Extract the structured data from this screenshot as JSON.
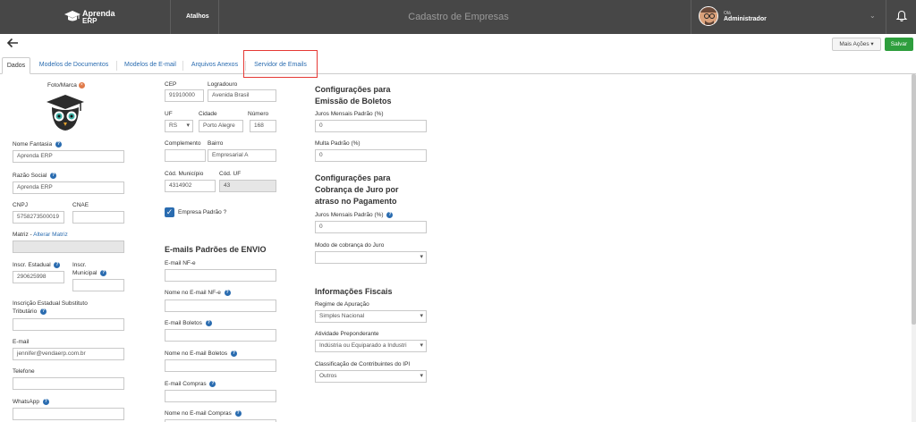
{
  "header": {
    "logo_line1": "Aprenda",
    "logo_line2": "ERP",
    "shortcuts": "Atalhos",
    "title": "Cadastro de Empresas",
    "user_greeting": "Olá",
    "user_name": "Administrador"
  },
  "toolbar": {
    "more_actions": "Mais Ações",
    "save": "Salvar"
  },
  "tabs": [
    {
      "label": "Dados",
      "active": true
    },
    {
      "label": "Modelos de Documentos",
      "active": false
    },
    {
      "label": "Modelos de E-mail",
      "active": false
    },
    {
      "label": "Arquivos Anexos",
      "active": false
    },
    {
      "label": "Servidor de Emails",
      "active": false,
      "highlighted": true
    }
  ],
  "col1": {
    "photo_label": "Foto/Marca",
    "nome_fantasia_label": "Nome Fantasia",
    "nome_fantasia_value": "Aprenda ERP",
    "razao_social_label": "Razão Social",
    "razao_social_value": "Aprenda ERP",
    "cnpj_label": "CNPJ",
    "cnpj_value": "5758273500019",
    "cnae_label": "CNAE",
    "cnae_value": "",
    "matriz_label": "Matriz -",
    "matriz_link": "Alterar Matriz",
    "inscr_estadual_label": "Inscr. Estadual",
    "inscr_estadual_value": "290625998",
    "inscr_municipal_label1": "Inscr.",
    "inscr_municipal_label2": "Municipal",
    "inscr_municipal_value": "",
    "inscr_subst_label1": "Inscrição Estadual Substituto",
    "inscr_subst_label2": "Tributário",
    "email_label": "E-mail",
    "email_value": "jennifer@vendaerp.com.br",
    "telefone_label": "Telefone",
    "whatsapp_label": "WhatsApp"
  },
  "col2": {
    "cep_label": "CEP",
    "cep_value": "91910000",
    "logradouro_label": "Logradouro",
    "logradouro_value": "Avenida Brasil",
    "uf_label": "UF",
    "uf_value": "RS",
    "cidade_label": "Cidade",
    "cidade_value": "Porto Alegre",
    "numero_label": "Número",
    "numero_value": "168",
    "complemento_label": "Complemento",
    "bairro_label": "Bairro",
    "bairro_value": "Empresarial A",
    "cod_municipio_label": "Cód. Município",
    "cod_municipio_value": "4314902",
    "cod_uf_label": "Cód. UF",
    "cod_uf_value": "43",
    "empresa_padrao_label": "Empresa Padrão ?",
    "emails_title": "E-mails Padrões de ENVIO",
    "email_nfe_label": "E-mail NF-e",
    "nome_email_nfe_label": "Nome no E-mail NF-e",
    "email_boletos_label": "E-mail Boletos",
    "nome_email_boletos_label": "Nome no E-mail Boletos",
    "email_compras_label": "E-mail Compras",
    "nome_email_compras_label": "Nome no E-mail Compras"
  },
  "col3": {
    "boletos_title1": "Configurações para",
    "boletos_title2": "Emissão de Boletos",
    "juros_label": "Juros Mensais Padrão (%)",
    "juros_value": "0",
    "multa_label": "Multa Padrão (%)",
    "multa_value": "0",
    "cobranca_title1": "Configurações para",
    "cobranca_title2": "Cobrança de Juro por",
    "cobranca_title3": "atraso no Pagamento",
    "juros2_label": "Juros Mensais Padrão (%)",
    "juros2_value": "0",
    "modo_label": "Modo de cobrança do Juro",
    "modo_value": "",
    "fiscais_title": "Informações Fiscais",
    "regime_label": "Regime de Apuração",
    "regime_value": "Simples Nacional",
    "atividade_label": "Atividade Preponderante",
    "atividade_value": "Indústria ou Equiparado a Industri",
    "classificacao_label": "Classificação de Contribuintes do IPI",
    "classificacao_value": "Outros"
  },
  "colors": {
    "topbar": "#474747",
    "accent": "#2a6cb0",
    "save": "#2e9e3d",
    "highlight": "#e53935"
  }
}
